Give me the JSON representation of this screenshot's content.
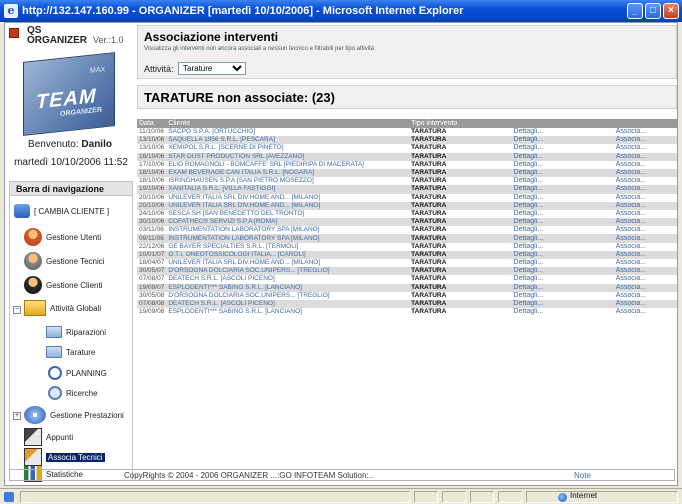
{
  "window": {
    "title": "http://132.147.160.99 - ORGANIZER [martedì 10/10/2006] - Microsoft Internet Explorer",
    "minimize": "_",
    "maximize": "□",
    "close": "×"
  },
  "left": {
    "brand_qs": "QS",
    "brand_name": "ORGANIZER",
    "brand_version": "Ver.:1.0",
    "logo_main": "TEAM",
    "logo_sub": "ORGANIZER",
    "logo_tag": "MAX",
    "welcome_prefix": "Benvenuto: ",
    "welcome_user": "Danilo",
    "datetime": "martedì 10/10/2006 11:52",
    "nav_title": "Barra di navigazione",
    "nav_items": [
      "[ CAMBIA CLIENTE ]",
      "Gestione Utenti",
      "Gestione Tecnici",
      "Gestione Clienti",
      "Attività Globali",
      "Riparazioni",
      "Tarature",
      "PLANNING",
      "Ricerche",
      "Gestione Prestazioni",
      "Appunti",
      "Associa Tecnici",
      "Statistiche"
    ]
  },
  "main": {
    "heading": "Associazione interventi",
    "subheading": "Visualizza gli interventi non ancora associati a nessun tecnico e filtrabili per tipo attività",
    "activity_label": "Attività:",
    "activity_value": "Tarature",
    "section_title": "TARATURE non associate: (23)",
    "columns": [
      "Data",
      "Cliente",
      "Tipo intervento",
      "",
      ""
    ],
    "rows": [
      [
        "11/10/06",
        "SACPO S.P.A. [ORTUCCHIO]",
        "TARATURA",
        "Dettagli...",
        "Associa..."
      ],
      [
        "13/10/06",
        "SAQUELLA 1956 S.R.L. [PESCARA]",
        "TARATURA",
        "Dettagli...",
        "Associa..."
      ],
      [
        "13/10/06",
        "XEMIPOL S.R.L. [SCERNE DI PINETO]",
        "TARATURA",
        "Dettagli...",
        "Associa..."
      ],
      [
        "16/10/06",
        "STAR DUST PRODUCTION SRL [AVEZZANO]",
        "TARATURA",
        "Dettagli...",
        "Associa..."
      ],
      [
        "17/10/06",
        "ELIO ROMAGNOLI - BOMCAFFE' SRL [PIEDIRIPA DI MACERATA]",
        "TARATURA",
        "Dettagli...",
        "Associa..."
      ],
      [
        "18/10/06",
        "EXAM BEVERAGE CAN ITALIA S.R.L. [NOGARA]",
        "TARATURA",
        "Dettagli...",
        "Associa..."
      ],
      [
        "18/10/06",
        "ISRINGHAUSEN S.P.A [SAN PIETRO MOSEZZO]",
        "TARATURA",
        "Dettagli...",
        "Associa..."
      ],
      [
        "19/10/06",
        "XANITALIA S.R.L. [VILLA FASTIGGI]",
        "TARATURA",
        "Dettagli...",
        "Associa..."
      ],
      [
        "20/10/06",
        "UNILEVER ITALIA SRL DIV.HOME AND... [MILANO]",
        "TARATURA",
        "Dettagli...",
        "Associa..."
      ],
      [
        "20/10/06",
        "UNILEVER ITALIA SRL DIV.HOME AND... [MILANO]",
        "TARATURA",
        "Dettagli...",
        "Associa..."
      ],
      [
        "24/10/06",
        "SESCA SH [SAN BENEDETTO DEL TRONTO]",
        "TARATURA",
        "Dettagli...",
        "Associa..."
      ],
      [
        "30/10/06",
        "COFATHEC® SERVIZI S.P.A [ROMA]",
        "TARATURA",
        "Dettagli...",
        "Associa..."
      ],
      [
        "03/11/06",
        "INSTRUMENTATION LABORATORY SPA [MILANO]",
        "TARATURA",
        "Dettagli...",
        "Associa..."
      ],
      [
        "09/11/06",
        "INSTRUMENTATION LABORATORY SPA [MILANO]",
        "TARATURA",
        "Dettagli...",
        "Associa..."
      ],
      [
        "22/12/06",
        "GE BAYER SPECIALTIES S.R.L. [TERMOLI]",
        "TARATURA",
        "Dettagli...",
        "Associa..."
      ],
      [
        "10/01/07",
        "O.T.I. ONEOTOSSICOLOGI ITALIA... [CAROLI]",
        "TARATURA",
        "Dettagli...",
        "Associa..."
      ],
      [
        "18/04/07",
        "UNILEVER ITALIA SRL DIV.HOME AND... [MILANO]",
        "TARATURA",
        "Dettagli...",
        "Associa..."
      ],
      [
        "30/05/07",
        "D'ORSOGNA DOLCIARIA SOC.UNIPERS... [TREGLIO]",
        "TARATURA",
        "Dettagli...",
        "Associa..."
      ],
      [
        "07/08/07",
        "DEATECH S.R.L. [ASCOLI PICENO]",
        "TARATURA",
        "Dettagli...",
        "Associa..."
      ],
      [
        "19/09/07",
        "ESPLODENTI*** SABINO S.R.L. [LANCIANO]",
        "TARATURA",
        "Dettagli...",
        "Associa..."
      ],
      [
        "30/05/08",
        "D'ORSOGNA DOLCIARIA SOC.UNIPERS... [TREGLIO]",
        "TARATURA",
        "Dettagli...",
        "Associa..."
      ],
      [
        "07/08/08",
        "DEATECH S.R.L. [ASCOLI PICENO]",
        "TARATURA",
        "Dettagli...",
        "Associa..."
      ],
      [
        "19/09/08",
        "ESPLODENTI*** SABINO S.R.L. [LANCIANO]",
        "TARATURA",
        "Dettagli...",
        "Associa..."
      ]
    ],
    "footer_copyright": "CopyRights © 2004 - 2006 ORGANIZER ...:GO INFOTEAM Solution:..",
    "footer_note": "Note"
  },
  "statusbar": {
    "zone": "Internet"
  }
}
